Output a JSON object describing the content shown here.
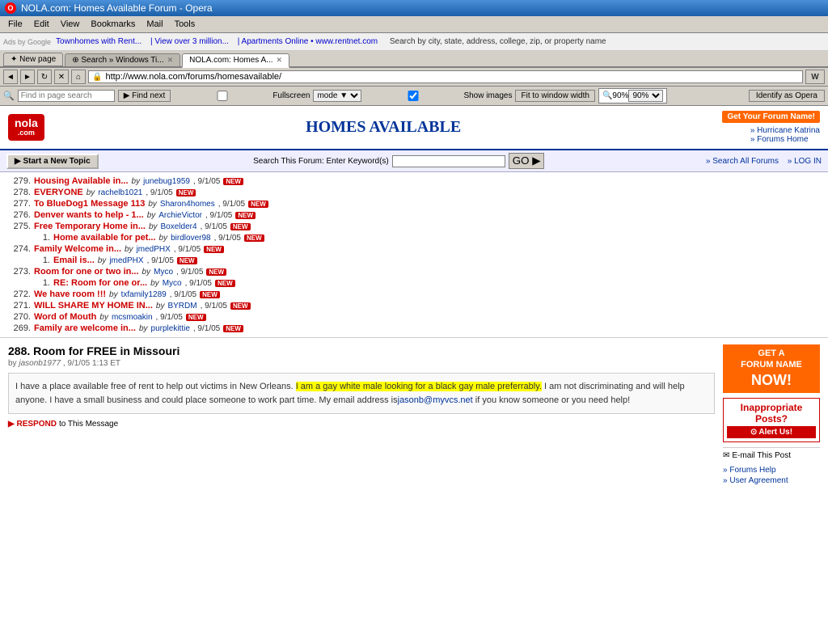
{
  "titlebar": {
    "title": "NOLA.com: Homes Available Forum - Opera",
    "icon": "O"
  },
  "menubar": {
    "items": [
      "File",
      "Edit",
      "View",
      "Bookmarks",
      "Mail",
      "Tools"
    ]
  },
  "adbar": {
    "ads_label": "Ads by Google",
    "ad1": "Townhomes with Rent...",
    "ad2": "View over 3 million...",
    "ad3": "Apartments Online • www.rentnet.com",
    "ad4": "Search by city, state, address, college, zip, or property name"
  },
  "tabs": {
    "new_page_label": "✦ New page",
    "tab1_label": "⊕ Search » Windows Ti...",
    "tab2_label": "NOLA.com: Homes A...",
    "close_icon": "✕"
  },
  "navbar": {
    "back_icon": "◄",
    "forward_icon": "►",
    "reload_icon": "↻",
    "stop_icon": "✕",
    "home_icon": "⌂",
    "url": "http://www.nola.com/forums/homesavailable/",
    "wiki_label": "W"
  },
  "findbar": {
    "find_label": "Find in page search",
    "find_next_label": "▶ Find next",
    "fullscreen_label": "Fullscreen",
    "rendering_mode_label": "mode ▼",
    "show_images_label": "Show images",
    "fit_label": "Fit to window width",
    "zoom": "90%",
    "identify_label": "Identify as Opera"
  },
  "forum": {
    "logo_line1": "nola",
    "logo_line2": ".com",
    "title": "HOMES AVAILABLE",
    "header_links": [
      "» Hurricane Katrina",
      "» Forums Home"
    ],
    "get_forum_name_label": "Get Your\nForum Name!",
    "new_topic_label": "▶ Start a New Topic",
    "search_label": "Search This  Forum:  Enter Keyword(s)",
    "go_label": "GO ▶",
    "search_all_label": "» Search  All  Forums",
    "log_in_label": "» LOG IN",
    "threads": [
      {
        "num": "279.",
        "title": "Housing Available in...",
        "by": "by",
        "author": "junebug1959",
        "date": "9/1/05",
        "new": true,
        "indent": false
      },
      {
        "num": "278.",
        "title": "EVERYONE",
        "by": "by",
        "author": "rachelb1021",
        "date": "9/1/05",
        "new": true,
        "indent": false
      },
      {
        "num": "277.",
        "title": "To BlueDog1 Message 113",
        "by": "by",
        "author": "Sharon4homes",
        "date": "9/1/05",
        "new": true,
        "indent": false
      },
      {
        "num": "276.",
        "title": "Denver wants to help - 1...",
        "by": "by",
        "author": "ArchieVictor",
        "date": "9/1/05",
        "new": true,
        "indent": false
      },
      {
        "num": "275.",
        "title": "Free Temporary Home in...",
        "by": "by",
        "author": "Boxelder4",
        "date": "9/1/05",
        "new": true,
        "indent": false
      },
      {
        "num": "1.",
        "title": "Home available for pet...",
        "by": "by",
        "author": "birdlover98",
        "date": "9/1/05",
        "new": true,
        "indent": true
      },
      {
        "num": "274.",
        "title": "Family Welcome in...",
        "by": "by",
        "author": "jmedPHX",
        "date": "9/1/05",
        "new": true,
        "indent": false
      },
      {
        "num": "1.",
        "title": "Email is...",
        "by": "by",
        "author": "jmedPHX",
        "date": "9/1/05",
        "new": true,
        "indent": true
      },
      {
        "num": "273.",
        "title": "Room for one or two in...",
        "by": "by",
        "author": "Myco",
        "date": "9/1/05",
        "new": true,
        "indent": false
      },
      {
        "num": "1.",
        "title": "RE: Room for one or...",
        "by": "by",
        "author": "Myco",
        "date": "9/1/05",
        "new": true,
        "indent": true
      },
      {
        "num": "272.",
        "title": "We have room !!!",
        "by": "by",
        "author": "txfamily1289",
        "date": "9/1/05",
        "new": true,
        "indent": false
      },
      {
        "num": "271.",
        "title": "WILL SHARE MY HOME IN...",
        "by": "by",
        "author": "BYRDM",
        "date": "9/1/05",
        "new": true,
        "indent": false
      },
      {
        "num": "270.",
        "title": "Word of Mouth",
        "by": "by",
        "author": "mcsmoakin",
        "date": "9/1/05",
        "new": true,
        "indent": false
      },
      {
        "num": "269.",
        "title": "Family are welcome in...",
        "by": "by",
        "author": "purplekittie",
        "date": "9/1/05",
        "new": true,
        "indent": false
      }
    ],
    "post": {
      "number": "288.",
      "title": "Room for FREE in Missouri",
      "author": "jasonb1977",
      "date": "9/1/05 1:13 ET",
      "body_before": "I have a place available free of rent to help out victims in New Orleans. ",
      "body_highlight": "I am a gay white male looking for a black gay male preferrably.",
      "body_after": " I am not discriminating and will help anyone. I have a small business and could place someone to work part time. My email address is",
      "email": "jasonb@myvcs.net",
      "body_end": " if you know someone or you need help!",
      "respond_label": "▶ RESPOND",
      "respond_suffix": "to This Message"
    },
    "sidebar": {
      "get_name_label": "GET A\nFORUM NAME",
      "now_label": "NOW!",
      "inappropriate_label": "Inappropriate",
      "posts_label": "Posts?",
      "alert_icon": "⊙",
      "alert_label": "Alert Us!",
      "email_icon": "✉",
      "email_label": "E-mail This Post",
      "links": [
        "Forums Help",
        "User Agreement"
      ]
    }
  }
}
